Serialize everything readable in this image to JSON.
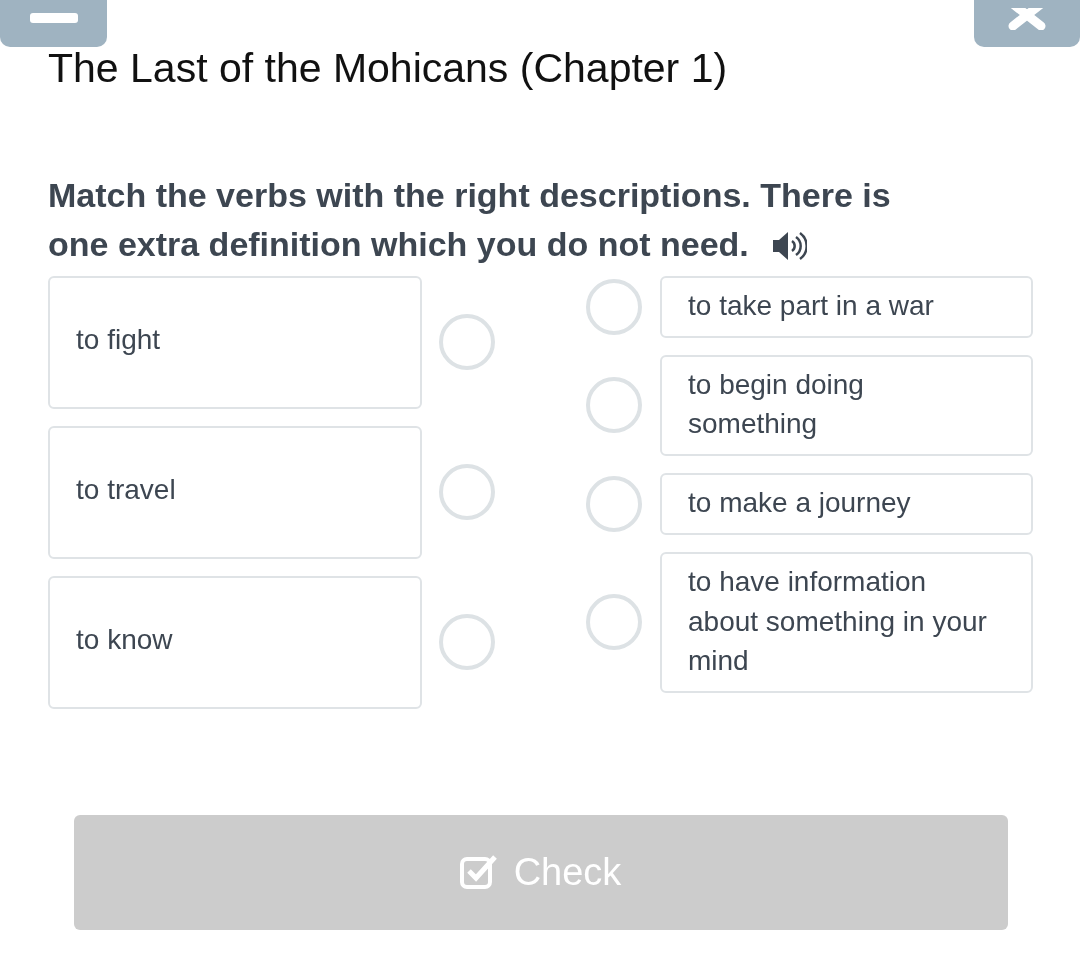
{
  "title": "The Last of the Mohicans (Chapter 1)",
  "instruction_lines": [
    "Match the verbs with the right descriptions. There is",
    "one extra definition which you do not need."
  ],
  "verbs": [
    {
      "text": "to fight"
    },
    {
      "text": "to travel"
    },
    {
      "text": "to know"
    }
  ],
  "descriptions": [
    {
      "text": "to take part in a war"
    },
    {
      "text": "to begin doing something"
    },
    {
      "text": "to make a journey"
    },
    {
      "text": "to have information about something in your mind"
    }
  ],
  "check_button": {
    "label": "Check",
    "disabled": true
  }
}
